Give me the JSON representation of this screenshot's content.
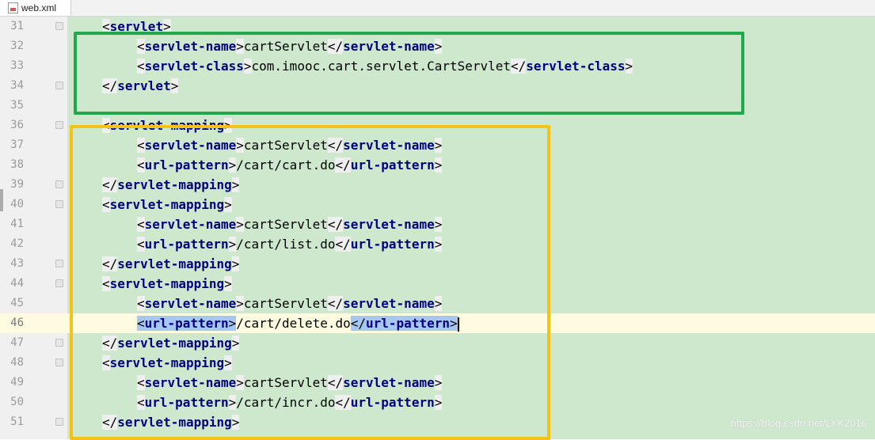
{
  "tab": {
    "filename": "web.xml",
    "icon": "xml-file-icon"
  },
  "watermark": "https://blog.csdn.net/LYK2016",
  "colors": {
    "editor_background": "#cde8cd",
    "gutter_background": "#f0f0f0",
    "current_line": "#fffbe0",
    "tag_name": "#000080",
    "selection": "#a6c8f0",
    "green_box": "#21a84a",
    "yellow_box": "#f5c21a"
  },
  "current_line": 46,
  "lines": [
    {
      "num": "31",
      "indent": 1,
      "tokens": [
        [
          "<",
          "tag"
        ],
        [
          "servlet",
          "tagname"
        ],
        [
          ">",
          "tag"
        ]
      ]
    },
    {
      "num": "32",
      "indent": 2,
      "tokens": [
        [
          "<",
          "tag"
        ],
        [
          "servlet-name",
          "tagname"
        ],
        [
          ">",
          "tag"
        ],
        [
          "cartServlet",
          "txt"
        ],
        [
          "</",
          "tag"
        ],
        [
          "servlet-name",
          "tagname"
        ],
        [
          ">",
          "tag"
        ]
      ]
    },
    {
      "num": "33",
      "indent": 2,
      "tokens": [
        [
          "<",
          "tag"
        ],
        [
          "servlet-class",
          "tagname"
        ],
        [
          ">",
          "tag"
        ],
        [
          "com.imooc.cart.servlet.CartServlet",
          "txt"
        ],
        [
          "</",
          "tag"
        ],
        [
          "servlet-class",
          "tagname"
        ],
        [
          ">",
          "tag"
        ]
      ]
    },
    {
      "num": "34",
      "indent": 1,
      "tokens": [
        [
          "</",
          "tag"
        ],
        [
          "servlet",
          "tagname"
        ],
        [
          ">",
          "tag"
        ]
      ]
    },
    {
      "num": "35",
      "indent": 0,
      "tokens": []
    },
    {
      "num": "36",
      "indent": 1,
      "tokens": [
        [
          "<",
          "tag"
        ],
        [
          "servlet-mapping",
          "tagname"
        ],
        [
          ">",
          "tag"
        ]
      ]
    },
    {
      "num": "37",
      "indent": 2,
      "tokens": [
        [
          "<",
          "tag"
        ],
        [
          "servlet-name",
          "tagname"
        ],
        [
          ">",
          "tag"
        ],
        [
          "cartServlet",
          "txt"
        ],
        [
          "</",
          "tag"
        ],
        [
          "servlet-name",
          "tagname"
        ],
        [
          ">",
          "tag"
        ]
      ]
    },
    {
      "num": "38",
      "indent": 2,
      "tokens": [
        [
          "<",
          "tag"
        ],
        [
          "url-pattern",
          "tagname"
        ],
        [
          ">",
          "tag"
        ],
        [
          "/cart/cart.do",
          "txt"
        ],
        [
          "</",
          "tag"
        ],
        [
          "url-pattern",
          "tagname"
        ],
        [
          ">",
          "tag"
        ]
      ]
    },
    {
      "num": "39",
      "indent": 1,
      "tokens": [
        [
          "</",
          "tag"
        ],
        [
          "servlet-mapping",
          "tagname"
        ],
        [
          ">",
          "tag"
        ]
      ]
    },
    {
      "num": "40",
      "indent": 1,
      "tokens": [
        [
          "<",
          "tag"
        ],
        [
          "servlet-mapping",
          "tagname"
        ],
        [
          ">",
          "tag"
        ]
      ]
    },
    {
      "num": "41",
      "indent": 2,
      "tokens": [
        [
          "<",
          "tag"
        ],
        [
          "servlet-name",
          "tagname"
        ],
        [
          ">",
          "tag"
        ],
        [
          "cartServlet",
          "txt"
        ],
        [
          "</",
          "tag"
        ],
        [
          "servlet-name",
          "tagname"
        ],
        [
          ">",
          "tag"
        ]
      ]
    },
    {
      "num": "42",
      "indent": 2,
      "tokens": [
        [
          "<",
          "tag"
        ],
        [
          "url-pattern",
          "tagname"
        ],
        [
          ">",
          "tag"
        ],
        [
          "/cart/list.do",
          "txt"
        ],
        [
          "</",
          "tag"
        ],
        [
          "url-pattern",
          "tagname"
        ],
        [
          ">",
          "tag"
        ]
      ]
    },
    {
      "num": "43",
      "indent": 1,
      "tokens": [
        [
          "</",
          "tag"
        ],
        [
          "servlet-mapping",
          "tagname"
        ],
        [
          ">",
          "tag"
        ]
      ]
    },
    {
      "num": "44",
      "indent": 1,
      "tokens": [
        [
          "<",
          "tag"
        ],
        [
          "servlet-mapping",
          "tagname"
        ],
        [
          ">",
          "tag"
        ]
      ]
    },
    {
      "num": "45",
      "indent": 2,
      "tokens": [
        [
          "<",
          "tag"
        ],
        [
          "servlet-name",
          "tagname"
        ],
        [
          ">",
          "tag"
        ],
        [
          "cartServlet",
          "txt"
        ],
        [
          "</",
          "tag"
        ],
        [
          "servlet-name",
          "tagname"
        ],
        [
          ">",
          "tag"
        ]
      ]
    },
    {
      "num": "46",
      "indent": 2,
      "tokens": [
        [
          "<",
          "sel"
        ],
        [
          "url-pattern",
          "sel"
        ],
        [
          ">",
          "sel"
        ],
        [
          "/cart/delete.do",
          "txt"
        ],
        [
          "</",
          "sel"
        ],
        [
          "url-pattern",
          "sel"
        ],
        [
          ">",
          "sel"
        ]
      ]
    },
    {
      "num": "47",
      "indent": 1,
      "tokens": [
        [
          "</",
          "tag"
        ],
        [
          "servlet-mapping",
          "tagname"
        ],
        [
          ">",
          "tag"
        ]
      ]
    },
    {
      "num": "48",
      "indent": 1,
      "tokens": [
        [
          "<",
          "tag"
        ],
        [
          "servlet-mapping",
          "tagname"
        ],
        [
          ">",
          "tag"
        ]
      ]
    },
    {
      "num": "49",
      "indent": 2,
      "tokens": [
        [
          "<",
          "tag"
        ],
        [
          "servlet-name",
          "tagname"
        ],
        [
          ">",
          "tag"
        ],
        [
          "cartServlet",
          "txt"
        ],
        [
          "</",
          "tag"
        ],
        [
          "servlet-name",
          "tagname"
        ],
        [
          ">",
          "tag"
        ]
      ]
    },
    {
      "num": "50",
      "indent": 2,
      "tokens": [
        [
          "<",
          "tag"
        ],
        [
          "url-pattern",
          "tagname"
        ],
        [
          ">",
          "tag"
        ],
        [
          "/cart/incr.do",
          "txt"
        ],
        [
          "</",
          "tag"
        ],
        [
          "url-pattern",
          "tagname"
        ],
        [
          ">",
          "tag"
        ]
      ]
    },
    {
      "num": "51",
      "indent": 1,
      "tokens": [
        [
          "</",
          "tag"
        ],
        [
          "servlet-mapping",
          "tagname"
        ],
        [
          ">",
          "tag"
        ]
      ]
    }
  ]
}
